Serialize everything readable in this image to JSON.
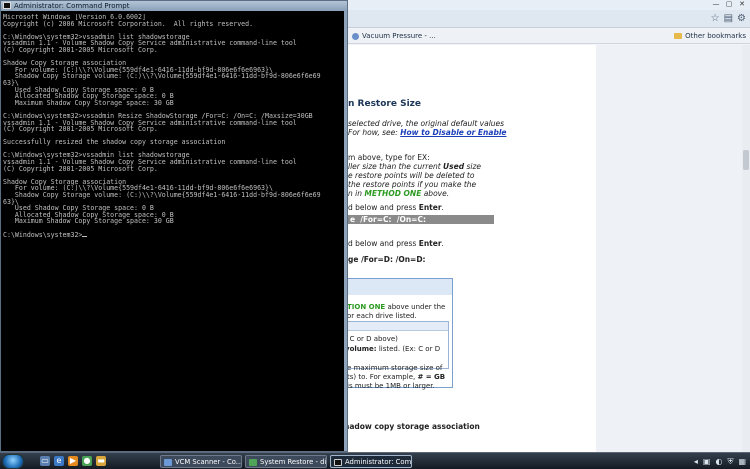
{
  "browser": {
    "bookmark_item": "Vacuum Pressure - ...",
    "other_bookmarks": "Other bookmarks",
    "page": {
      "heading": "n Restore Size",
      "p1": [
        "selected drive, the original default values",
        "For how, see: "
      ],
      "p1_link": "How to Disable or Enable",
      "p2_pre": "m above, type for EX:",
      "p3": [
        "ller size than the current ",
        " size",
        "e restore points will be deleted to",
        "the restore points if you make the",
        "n in ",
        " above."
      ],
      "p3_used": "Used",
      "p3_method": "METHOD ONE",
      "p4_pre": "d below and press ",
      "p4_enter": "Enter",
      "cmd1": "e  /For=C:  /On=C:",
      "p5_pre": "d below and press ",
      "p5_enter": "Enter",
      "cmd2": "ge   /For=D:   /On=D:",
      "note": {
        "l1_green": "TION ONE",
        "l1_rest": " above under the",
        "l2": "or each drive listed.",
        "l3": ": C or D above)",
        "l4_bold": "volume:",
        "l4_rest": " listed. (Ex: C or D",
        "l5": "e  maximum  storage  size  of",
        "l6_pre": "ts) to. For example, ",
        "l6_bold": "# = GB",
        "l7": "is must be 1MB or larger."
      },
      "footer": "hadow  copy  storage  association"
    }
  },
  "cmd": {
    "title": "Administrator: Command Prompt",
    "lines": [
      "Microsoft Windows [Version 6.0.6002]",
      "Copyright (c) 2006 Microsoft Corporation.  All rights reserved.",
      "",
      "C:\\Windows\\system32>vssadmin list shadowstorage",
      "vssadmin 1.1 - Volume Shadow Copy Service administrative command-line tool",
      "(C) Copyright 2001-2005 Microsoft Corp.",
      "",
      "Shadow Copy Storage association",
      "   For volume: (C:)\\\\?\\Volume{559df4e1-6416-11dd-bf9d-806e6f6e6963}\\",
      "   Shadow Copy Storage volume: (C:)\\\\?\\Volume{559df4e1-6416-11dd-bf9d-806e6f6e69",
      "63}\\",
      "   Used Shadow Copy Storage space: 0 B",
      "   Allocated Shadow Copy Storage space: 0 B",
      "   Maximum Shadow Copy Storage space: 30 GB",
      "",
      "C:\\Windows\\system32>vssadmin Resize ShadowStorage /For=C: /On=C: /Maxsize=30GB",
      "vssadmin 1.1 - Volume Shadow Copy Service administrative command-line tool",
      "(C) Copyright 2001-2005 Microsoft Corp.",
      "",
      "Successfully resized the shadow copy storage association",
      "",
      "C:\\Windows\\system32>vssadmin list shadowstorage",
      "vssadmin 1.1 - Volume Shadow Copy Service administrative command-line tool",
      "(C) Copyright 2001-2005 Microsoft Corp.",
      "",
      "Shadow Copy Storage association",
      "   For volume: (C:)\\\\?\\Volume{559df4e1-6416-11dd-bf9d-806e6f6e6963}\\",
      "   Shadow Copy Storage volume: (C:)\\\\?\\Volume{559df4e1-6416-11dd-bf9d-806e6f6e69",
      "63}\\",
      "   Used Shadow Copy Storage space: 0 B",
      "   Allocated Shadow Copy Storage space: 0 B",
      "   Maximum Shadow Copy Storage space: 30 GB",
      "",
      "C:\\Windows\\system32>"
    ]
  },
  "taskbar": {
    "buttons": [
      "VCM Scanner - Co...",
      "System Restore - dis...",
      "Administrator: Com..."
    ]
  }
}
